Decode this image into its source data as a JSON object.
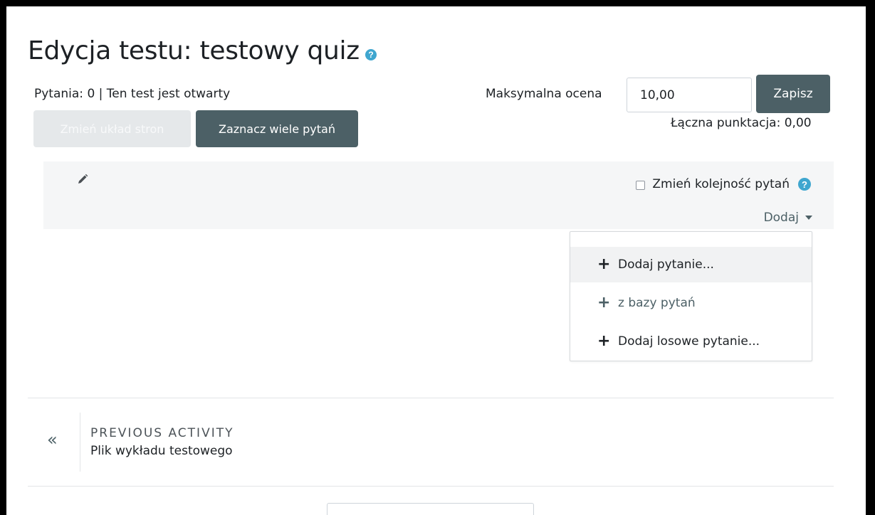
{
  "page": {
    "title": "Edycja testu: testowy quiz",
    "help_glyph": "?"
  },
  "status": {
    "summary": "Pytania: 0 | Ten test jest otwarty"
  },
  "actions": {
    "repaginate_label": "Zmień układ stron",
    "select_multiple_label": "Zaznacz wiele pytań"
  },
  "grade": {
    "label": "Maksymalna ocena",
    "value": "10,00",
    "save_label": "Zapisz",
    "total_points": "Łączna punktacja: 0,00"
  },
  "section": {
    "reorder_label": "Zmień kolejność pytań",
    "reorder_checked": false,
    "add_label": "Dodaj",
    "edit_icon": "pencil-icon"
  },
  "add_menu": {
    "items": [
      {
        "label": "Dodaj pytanie...",
        "icon": "plus-icon",
        "active": true
      },
      {
        "label": "z bazy pytań",
        "icon": "plus-icon",
        "active": false
      },
      {
        "label": "Dodaj losowe pytanie...",
        "icon": "plus-icon",
        "active": false
      }
    ]
  },
  "navigation": {
    "previous_heading": "PREVIOUS ACTIVITY",
    "previous_name": "Plik wykładu testowego",
    "previous_icon": "«"
  },
  "colors": {
    "primary": "#4c6066",
    "help": "#3fa6cf",
    "disabled": "#e5e8ea",
    "section_bg": "#f5f6f7"
  }
}
